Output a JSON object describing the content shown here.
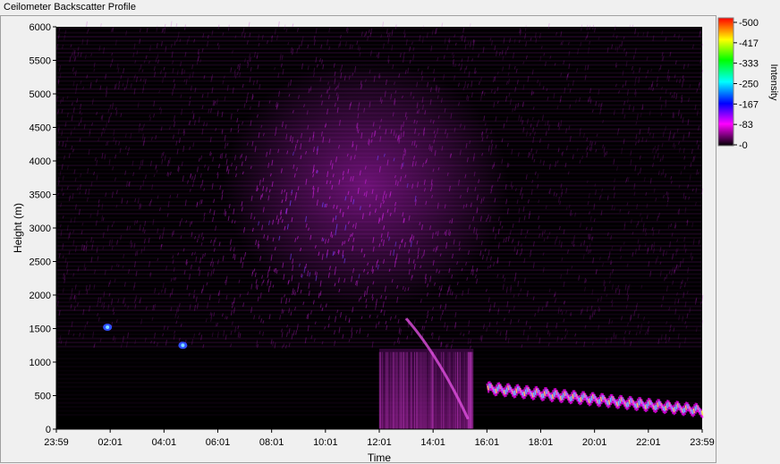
{
  "window": {
    "title": "Ceilometer Backscatter Profile"
  },
  "chart_data": {
    "type": "heatmap",
    "title": "",
    "xlabel": "Time",
    "ylabel": "Height (m)",
    "x_ticks": [
      "23:59",
      "02:01",
      "04:01",
      "06:01",
      "08:01",
      "10:01",
      "12:01",
      "14:01",
      "16:01",
      "18:01",
      "20:01",
      "22:01",
      "23:59"
    ],
    "y_ticks": [
      0,
      500,
      1000,
      1500,
      2000,
      2500,
      3000,
      3500,
      4000,
      4500,
      5000,
      5500,
      6000
    ],
    "ylim": [
      0,
      6000
    ],
    "xlim_hours": [
      0,
      24
    ],
    "colorbar": {
      "label": "Intensity",
      "ticks": [
        "-500",
        "-417",
        "-333",
        "-250",
        "-167",
        "-83",
        "-0"
      ],
      "colors": [
        "#000000",
        "#ff00ff",
        "#0000ff",
        "#00ffff",
        "#00ff00",
        "#ffff00",
        "#ff0000"
      ]
    },
    "features": [
      {
        "name": "elevated noise region",
        "time_hours": [
          7.5,
          15.5
        ],
        "height_m": [
          2000,
          4000
        ]
      },
      {
        "name": "aerosol layer",
        "time_hours": [
          16.0,
          24.0
        ],
        "height_m": [
          300,
          600
        ]
      },
      {
        "name": "isolated cloud",
        "time_hours": [
          1.9,
          1.9
        ],
        "height_m": [
          1520,
          1520
        ]
      },
      {
        "name": "isolated cloud",
        "time_hours": [
          4.7,
          4.7
        ],
        "height_m": [
          1250,
          1250
        ]
      },
      {
        "name": "boundary layer",
        "time_hours": [
          12.0,
          15.5
        ],
        "height_m": [
          0,
          1200
        ]
      }
    ],
    "grid": false,
    "legend": "colorbar right"
  },
  "colors": {
    "plot_bg": "#000000",
    "frame": "#a0a0a0",
    "window_bg": "#f0f0f0"
  }
}
